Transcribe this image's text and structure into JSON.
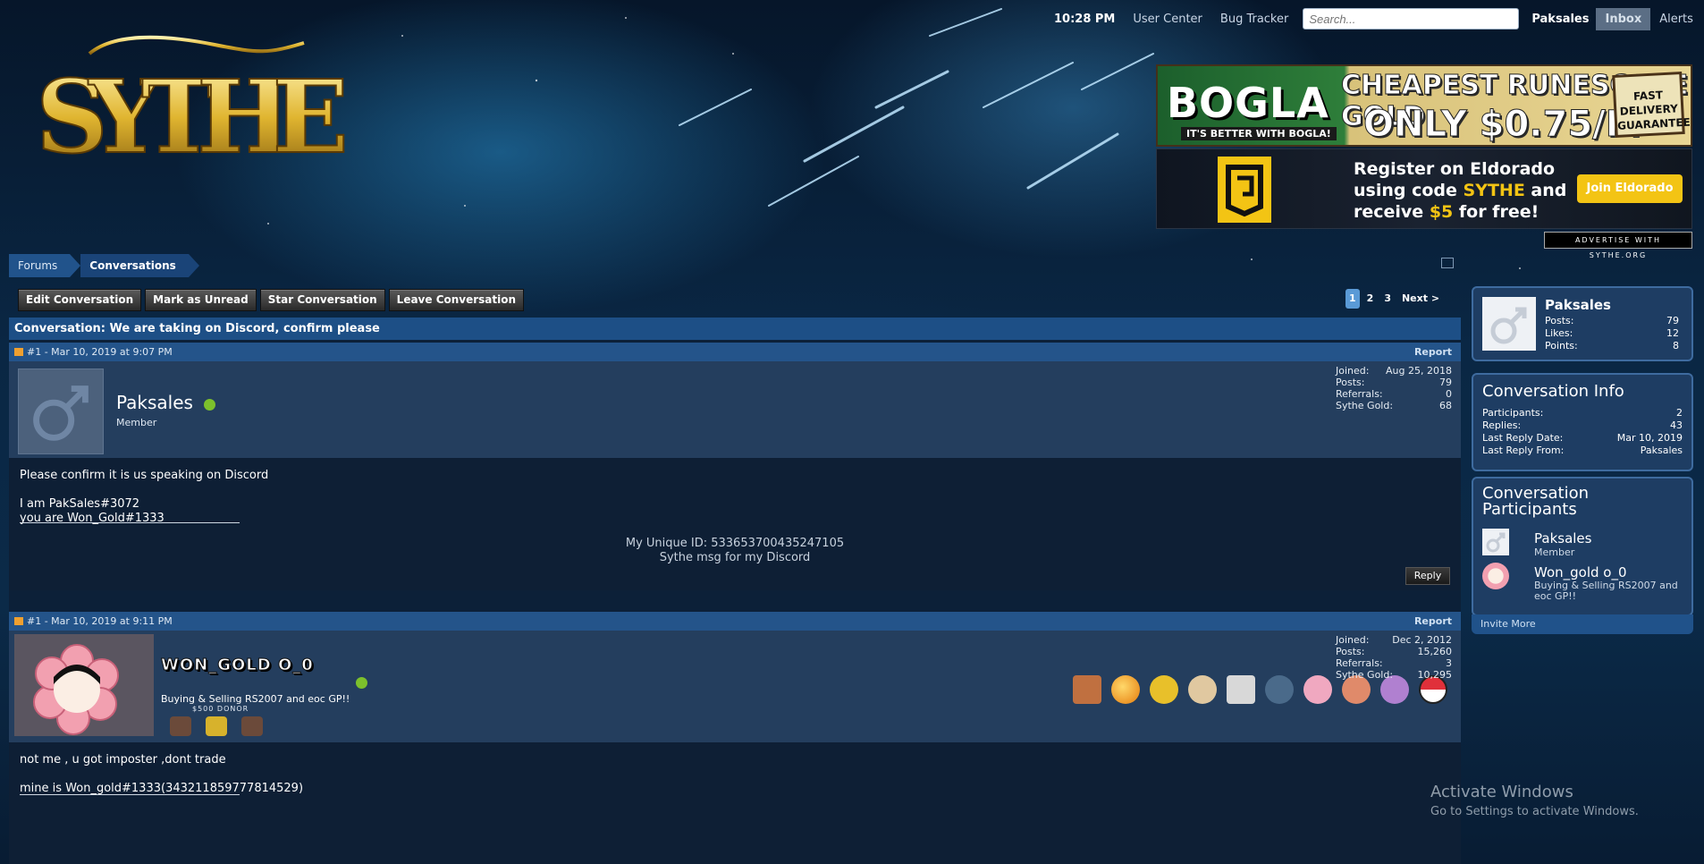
{
  "topbar": {
    "time": "10:28 PM",
    "user_center": "User Center",
    "bug_tracker": "Bug Tracker",
    "search_placeholder": "Search...",
    "username": "Paksales",
    "inbox": "Inbox",
    "alerts": "Alerts"
  },
  "logo": {
    "text": "SYTHE"
  },
  "ads": {
    "bogla": {
      "brand": "BOGLA",
      "tagline": "IT'S BETTER WITH BOGLA!",
      "headline1": "CHEAPEST RUNESCAPE GOLD",
      "headline2": "ONLY $0.75/M",
      "badge": "FAST DELIVERY GUARANTEED"
    },
    "eldorado": {
      "line1": "Register on Eldorado",
      "line2_a": "using code ",
      "code": "SYTHE",
      "line2_b": " and",
      "line3_a": "receive ",
      "amount": "$5",
      "line3_b": " for free!",
      "button": "Join Eldorado"
    },
    "advertise": "ADVERTISE WITH SYTHE.ORG"
  },
  "breadcrumb": {
    "forums": "Forums",
    "conversations": "Conversations"
  },
  "actions": {
    "edit": "Edit Conversation",
    "unread": "Mark as Unread",
    "star": "Star Conversation",
    "leave": "Leave Conversation"
  },
  "pager": {
    "p1": "1",
    "p2": "2",
    "p3": "3",
    "next": "Next >"
  },
  "conversation": {
    "title": "Conversation: We are taking on Discord, confirm please"
  },
  "posts": [
    {
      "meta": "#1 - Mar 10, 2019 at 9:07 PM",
      "report": "Report",
      "author": "Paksales",
      "title": "Member",
      "stats": [
        {
          "k": "Joined:",
          "v": "Aug 25, 2018"
        },
        {
          "k": "Posts:",
          "v": "79"
        },
        {
          "k": "Referrals:",
          "v": "0"
        },
        {
          "k": "Sythe Gold:",
          "v": "68"
        }
      ],
      "body": [
        "Please confirm it is us speaking on Discord",
        "I am PakSales#3072",
        "you are Won_Gold#1333"
      ],
      "sig1": "My Unique ID: 533653700435247105",
      "sig2": "Sythe msg for my Discord",
      "reply": "Reply"
    },
    {
      "meta": "#1 - Mar 10, 2019 at 9:11 PM",
      "report": "Report",
      "author": "WON_GOLD O_0",
      "title": "Buying & Selling RS2007 and eoc GP!!",
      "donor": "$500 DONOR",
      "stats": [
        {
          "k": "Joined:",
          "v": "Dec 2, 2012"
        },
        {
          "k": "Posts:",
          "v": "15,260"
        },
        {
          "k": "Referrals:",
          "v": "3"
        },
        {
          "k": "Sythe Gold:",
          "v": "10,295"
        }
      ],
      "body": [
        "not me , u got imposter ,dont trade",
        "mine is Won_gold#1333(343211859777814529)"
      ]
    }
  ],
  "sidebar": {
    "me": {
      "name": "Paksales",
      "stats": [
        {
          "k": "Posts:",
          "v": "79"
        },
        {
          "k": "Likes:",
          "v": "12"
        },
        {
          "k": "Points:",
          "v": "8"
        }
      ]
    },
    "info": {
      "heading": "Conversation Info",
      "rows": [
        {
          "k": "Participants:",
          "v": "2"
        },
        {
          "k": "Replies:",
          "v": "43"
        },
        {
          "k": "Last Reply Date:",
          "v": "Mar 10, 2019"
        },
        {
          "k": "Last Reply From:",
          "v": "Paksales"
        }
      ]
    },
    "participants": {
      "heading": "Conversation Participants",
      "list": [
        {
          "name": "Paksales",
          "title": "Member"
        },
        {
          "name": "Won_gold o_0",
          "title": "Buying & Selling RS2007 and eoc GP!!"
        }
      ],
      "invite": "Invite More"
    }
  },
  "watermark": {
    "line1": "Activate Windows",
    "line2": "Go to Settings to activate Windows."
  },
  "colors": {
    "accent": "#1d4f86",
    "online": "#7cc02c",
    "eldorado": "#f3c414"
  }
}
